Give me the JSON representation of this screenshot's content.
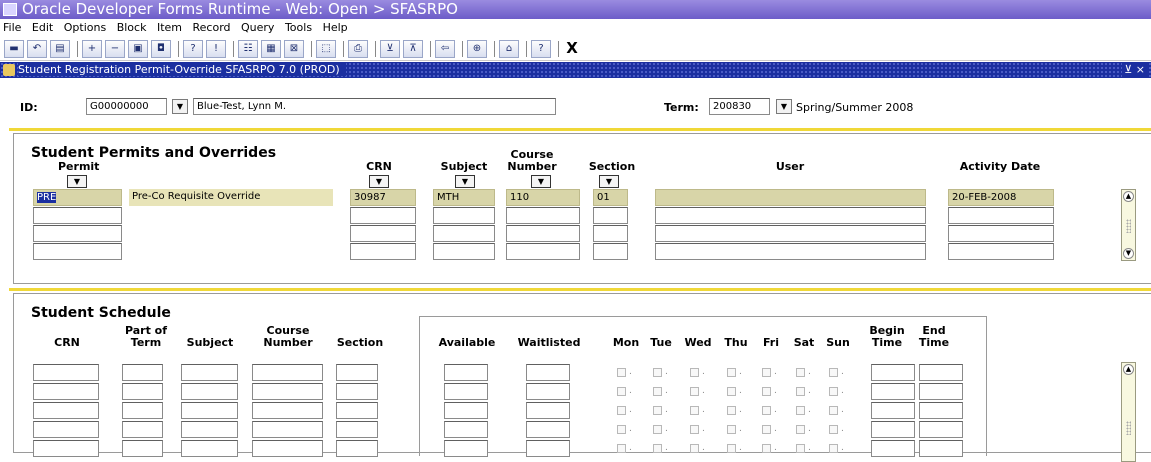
{
  "window": {
    "title": "Oracle Developer Forms Runtime - Web:  Open > SFASRPO"
  },
  "menu": [
    "File",
    "Edit",
    "Options",
    "Block",
    "Item",
    "Record",
    "Query",
    "Tools",
    "Help"
  ],
  "toolbar": {
    "buttons": [
      {
        "name": "save-icon",
        "glyph": "▬"
      },
      {
        "name": "rollback-icon",
        "glyph": "↶"
      },
      {
        "name": "print-icon",
        "glyph": "▤"
      },
      {
        "name": "sep"
      },
      {
        "name": "insert-record-icon",
        "glyph": "+"
      },
      {
        "name": "remove-record-icon",
        "glyph": "−"
      },
      {
        "name": "copy-record-icon",
        "glyph": "▣"
      },
      {
        "name": "block-icon",
        "glyph": "◘"
      },
      {
        "name": "sep"
      },
      {
        "name": "enter-query-icon",
        "glyph": "?"
      },
      {
        "name": "execute-query-icon",
        "glyph": "!"
      },
      {
        "name": "sep"
      },
      {
        "name": "options-icon",
        "glyph": "☷"
      },
      {
        "name": "list-icon",
        "glyph": "▦"
      },
      {
        "name": "close-form-icon",
        "glyph": "⊠"
      },
      {
        "name": "sep"
      },
      {
        "name": "tree-icon",
        "glyph": "⬚"
      },
      {
        "name": "sep"
      },
      {
        "name": "print-screen-icon",
        "glyph": "⎙"
      },
      {
        "name": "sep"
      },
      {
        "name": "prev-block-icon",
        "glyph": "⊻"
      },
      {
        "name": "next-block-icon",
        "glyph": "⊼"
      },
      {
        "name": "sep"
      },
      {
        "name": "attach-icon",
        "glyph": "⇦"
      },
      {
        "name": "sep"
      },
      {
        "name": "navigate-icon",
        "glyph": "⊕"
      },
      {
        "name": "sep"
      },
      {
        "name": "export-icon",
        "glyph": "⌂"
      },
      {
        "name": "sep"
      },
      {
        "name": "help-icon",
        "glyph": "?"
      },
      {
        "name": "sep"
      }
    ],
    "exit_label": "X"
  },
  "form": {
    "title": "Student Registration Permit-Override  SFASRPO  7.0  (PROD)",
    "win_ctrl": "⊻ ×"
  },
  "key_block": {
    "id_label": "ID:",
    "id_value": "G00000000",
    "name_value": "Blue-Test, Lynn M.",
    "term_label": "Term:",
    "term_value": "200830",
    "term_desc": "Spring/Summer 2008"
  },
  "permits": {
    "title": "Student Permits and Overrides",
    "headers": {
      "permit": "Permit",
      "crn": "CRN",
      "subject": "Subject",
      "course_number_1": "Course",
      "course_number_2": "Number",
      "section": "Section",
      "user": "User",
      "activity_date": "Activity Date"
    },
    "row1": {
      "permit": "PRE",
      "permit_desc": "Pre-Co Requisite Override",
      "crn": "30987",
      "subject": "MTH",
      "course_number": "110",
      "section": "01",
      "user": "",
      "activity_date": "20-FEB-2008"
    }
  },
  "schedule": {
    "title": "Student Schedule",
    "headers": {
      "crn": "CRN",
      "part_of_term_1": "Part of",
      "part_of_term_2": "Term",
      "subject": "Subject",
      "course_1": "Course",
      "course_2": "Number",
      "section": "Section",
      "available": "Available",
      "waitlisted": "Waitlisted",
      "mon": "Mon",
      "tue": "Tue",
      "wed": "Wed",
      "thu": "Thu",
      "fri": "Fri",
      "sat": "Sat",
      "sun": "Sun",
      "begin_1": "Begin",
      "begin_2": "Time",
      "end_1": "End",
      "end_2": "Time"
    }
  },
  "colors": {
    "title_bar": "#6c5cc8",
    "form_bar": "#1b2fa0",
    "divider": "#f0d838",
    "readonly_field": "#d8d5a8",
    "selected_text_bg": "#1b2fa0"
  }
}
